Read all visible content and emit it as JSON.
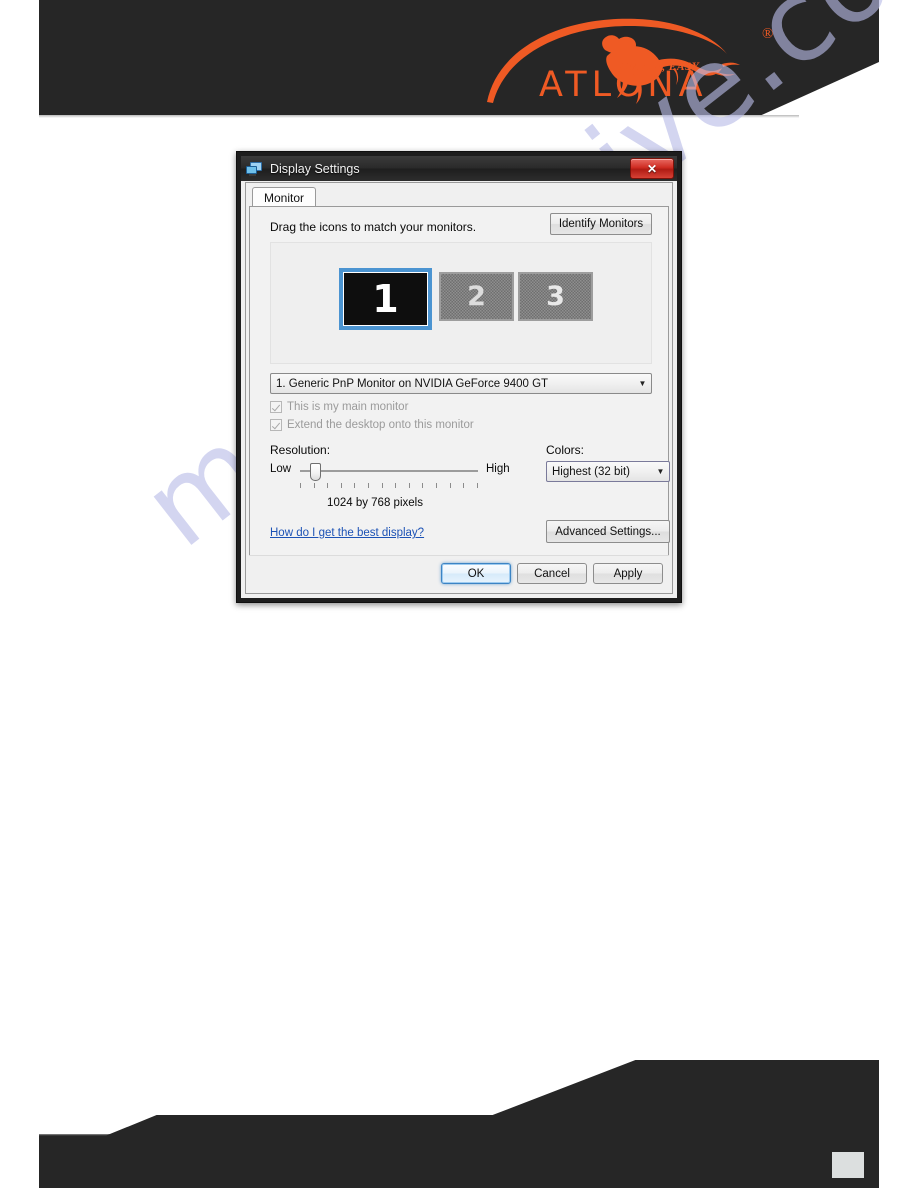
{
  "page": {
    "background_color": "#ffffff",
    "banner_color": "#262626",
    "accent_color": "#ef5a24",
    "watermark_text": "manualshive.com",
    "watermark_color": "#b9bce8",
    "page_number": ""
  },
  "brand": {
    "wordmark": "ATLONA",
    "tagline": "SIMPLE, EASY",
    "registered_mark": "®"
  },
  "dialog": {
    "title": "Display Settings",
    "title_icon": "display-settings-icon",
    "close_label": "✕",
    "tabs": [
      {
        "label": "Monitor",
        "active": true
      }
    ],
    "drag_hint": "Drag the icons to match your monitors.",
    "identify_monitors_label": "Identify Monitors",
    "monitors": [
      {
        "number": "1",
        "state": "selected"
      },
      {
        "number": "2",
        "state": "inactive"
      },
      {
        "number": "3",
        "state": "inactive"
      }
    ],
    "monitor_select": {
      "value": "1. Generic PnP Monitor on NVIDIA GeForce 9400 GT",
      "arrow": "▼"
    },
    "checkboxes": [
      {
        "label": "This is my main monitor",
        "checked": true,
        "disabled": true
      },
      {
        "label": "Extend the desktop onto this monitor",
        "checked": true,
        "disabled": true
      }
    ],
    "resolution": {
      "label": "Resolution:",
      "low_label": "Low",
      "high_label": "High",
      "value_text": "1024 by 768 pixels",
      "slider_position_percent": 6,
      "tick_count": 14
    },
    "colors": {
      "label": "Colors:",
      "value": "Highest (32 bit)",
      "arrow": "▼"
    },
    "help_link": "How do I get the best display?",
    "advanced_settings_label": "Advanced Settings...",
    "buttons": {
      "ok": "OK",
      "cancel": "Cancel",
      "apply": "Apply"
    }
  }
}
